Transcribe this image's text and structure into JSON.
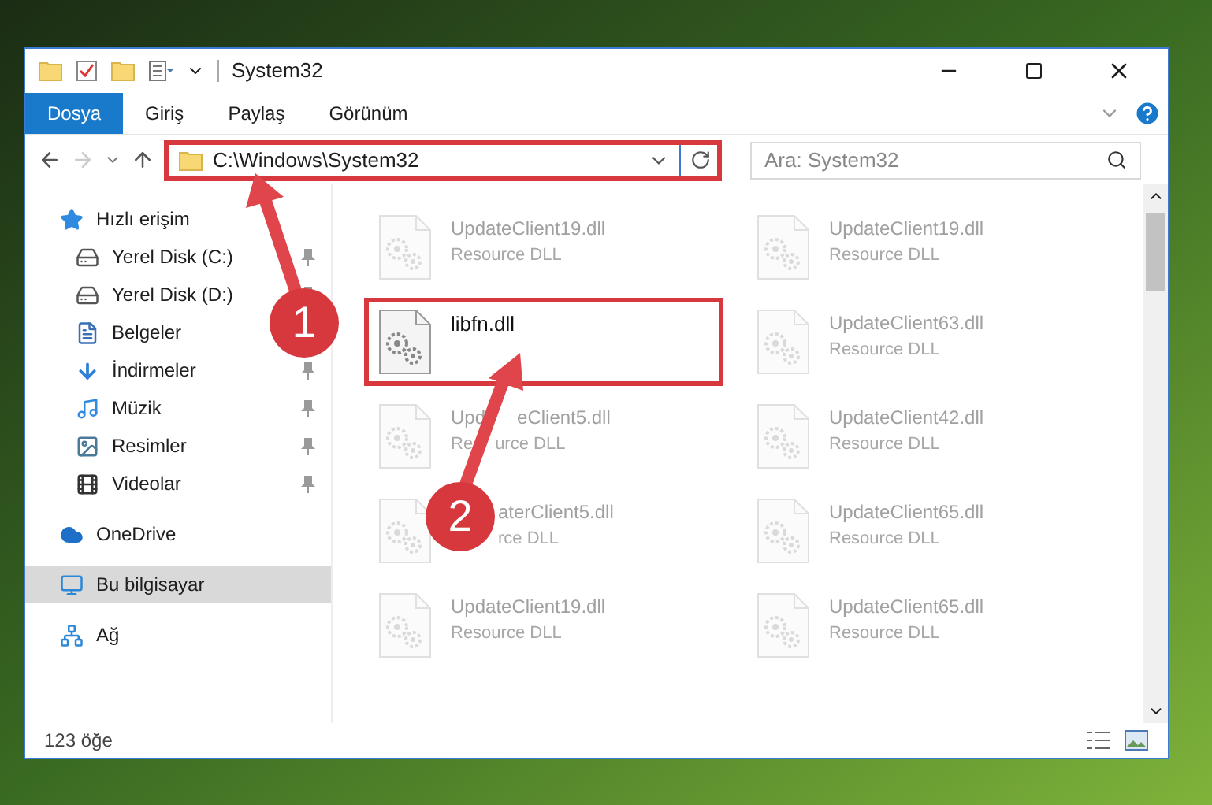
{
  "window": {
    "title": "System32"
  },
  "ribbon_tabs": [
    {
      "label": "Dosya",
      "selected": true
    },
    {
      "label": "Giriş",
      "selected": false
    },
    {
      "label": "Paylaş",
      "selected": false
    },
    {
      "label": "Görünüm",
      "selected": false
    }
  ],
  "address_bar": {
    "path": "C:\\Windows\\System32",
    "highlighted": true
  },
  "search": {
    "placeholder": "Ara: System32"
  },
  "sidebar": {
    "items": [
      {
        "label": "Hızlı erişim",
        "pinned": false,
        "selected": false,
        "children": [
          {
            "label": "Yerel Disk (C:)",
            "pinned": true,
            "selected": false
          },
          {
            "label": "Yerel Disk (D:)",
            "pinned": true,
            "selected": false
          },
          {
            "label": "Belgeler",
            "selected": false
          },
          {
            "label": "İndirmeler",
            "pinned": true,
            "selected": false
          },
          {
            "label": "Müzik",
            "pinned": true,
            "selected": false
          },
          {
            "label": "Resimler",
            "pinned": true,
            "selected": false
          },
          {
            "label": "Videolar",
            "pinned": true,
            "selected": false
          }
        ]
      },
      {
        "label": "OneDrive",
        "pinned": false,
        "selected": false
      },
      {
        "label": "Bu bilgisayar",
        "pinned": false,
        "selected": true
      },
      {
        "label": "Ağ",
        "pinned": false,
        "selected": false
      }
    ]
  },
  "files": [
    {
      "name": [
        "UpdateClient19.dll"
      ],
      "type": [
        "Resource DLL"
      ],
      "faded": true,
      "highlighted": false,
      "offset": false
    },
    {
      "name": [
        "UpdateClient19.dll"
      ],
      "type": [
        "Resource DLL"
      ],
      "faded": true,
      "highlighted": false,
      "offset": false
    },
    {
      "name": [
        "libfn.dll"
      ],
      "faded": false,
      "highlighted": true,
      "offset": false
    },
    {
      "name": [
        "UpdateClient63.dll"
      ],
      "type": [
        "Resource DLL"
      ],
      "faded": true,
      "highlighted": false,
      "offset": false
    },
    {
      "name": [
        "Upd",
        "eClient5.dll"
      ],
      "type": [
        "Re",
        "urce DLL"
      ],
      "faded": true,
      "highlighted": false,
      "offset": false
    },
    {
      "name": [
        "UpdateClient42.dll"
      ],
      "type": [
        "Resource DLL"
      ],
      "faded": true,
      "highlighted": false,
      "offset": false
    },
    {
      "name": [
        "aterClient5.dll"
      ],
      "type": [
        "rce DLL"
      ],
      "faded": true,
      "highlighted": false,
      "offset": true
    },
    {
      "name": [
        "UpdateClient65.dll"
      ],
      "type": [
        "Resource DLL"
      ],
      "faded": true,
      "highlighted": false,
      "offset": false
    },
    {
      "name": [
        "UpdateClient19.dll"
      ],
      "type": [
        "Resource DLL"
      ],
      "faded": true,
      "highlighted": false,
      "offset": false
    },
    {
      "name": [
        "UpdateClient65.dll"
      ],
      "type": [
        "Resource DLL"
      ],
      "faded": true,
      "highlighted": false,
      "offset": false
    }
  ],
  "status_bar": {
    "item_count": "123 öğe"
  },
  "callouts": [
    {
      "number": "1"
    },
    {
      "number": "2"
    }
  ]
}
